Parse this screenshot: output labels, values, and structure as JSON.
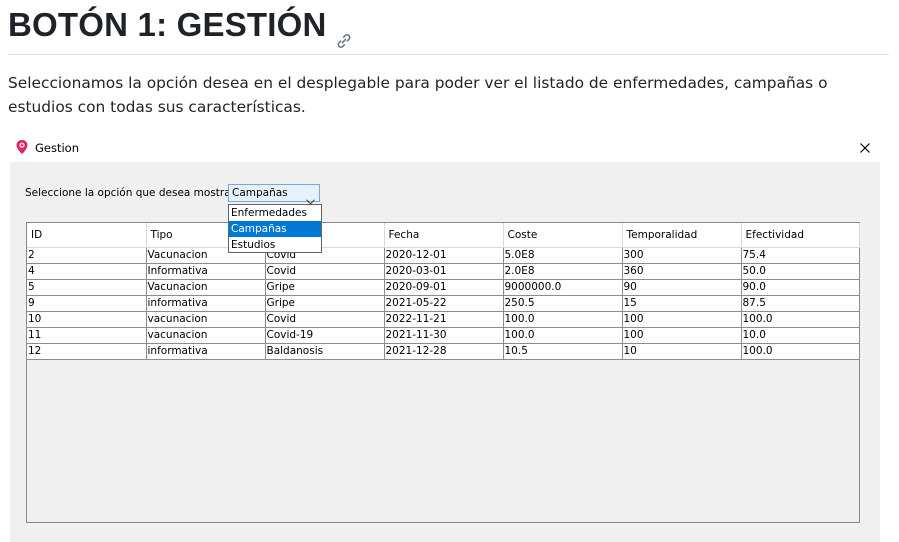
{
  "doc": {
    "heading": "BOTÓN 1: GESTIÓN",
    "paragraph": "Seleccionamos la opción desea en el desplegable para poder ver el listado de enfermedades, campañas o estudios con todas sus características."
  },
  "window": {
    "title": "Gestion",
    "option_label": "Seleccione la opción que desea mostrar:",
    "combo_value": "Campañas",
    "dropdown_options": [
      "Enfermedades",
      "Campañas",
      "Estudios"
    ],
    "selected_option": "Campañas",
    "table": {
      "columns": [
        "ID",
        "Tipo",
        "",
        "Fecha",
        "Coste",
        "Temporalidad",
        "Efectividad"
      ],
      "rows": [
        [
          "2",
          "Vacunacion",
          "Covid",
          "2020-12-01",
          "5.0E8",
          "300",
          "75.4"
        ],
        [
          "4",
          "Informativa",
          "Covid",
          "2020-03-01",
          "2.0E8",
          "360",
          "50.0"
        ],
        [
          "5",
          "Vacunacion",
          "Gripe",
          "2020-09-01",
          "9000000.0",
          "90",
          "90.0"
        ],
        [
          "9",
          "informativa",
          "Gripe",
          "2021-05-22",
          "250.5",
          "15",
          "87.5"
        ],
        [
          "10",
          "vacunacion",
          "Covid",
          "2022-11-21",
          "100.0",
          "100",
          "100.0"
        ],
        [
          "11",
          "vacunacion",
          "Covid-19",
          "2021-11-30",
          "100.0",
          "100",
          "10.0"
        ],
        [
          "12",
          "informativa",
          "Baldanosis",
          "2021-12-28",
          "10.5",
          "10",
          "100.0"
        ]
      ]
    }
  },
  "colors": {
    "selection": "#0078d7",
    "combo_bg": "#e5f1fb",
    "window_bg": "#f0f0f0",
    "app_icon": "#e0245e"
  },
  "icons": {
    "heading_link": "link-icon",
    "app": "map-pin-icon",
    "close": "close-icon",
    "combo_arrow": "chevron-down-icon"
  }
}
